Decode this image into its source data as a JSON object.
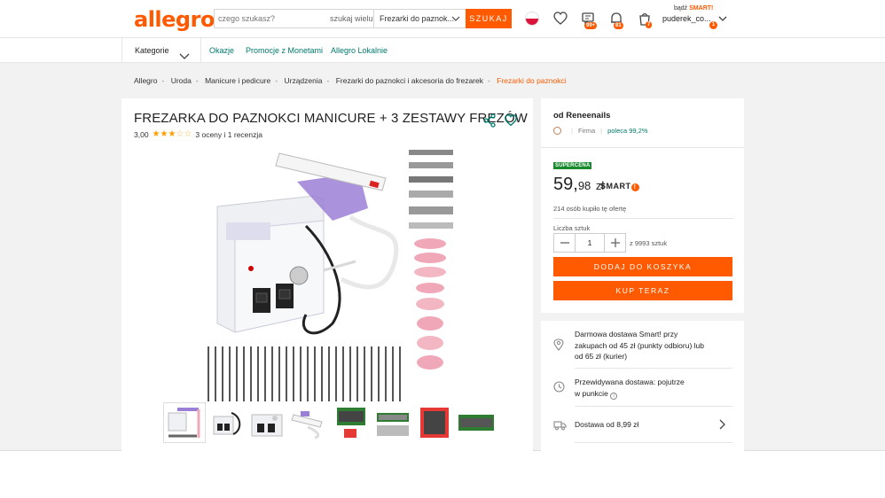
{
  "header": {
    "logo": "allegro",
    "search_placeholder": "czego szukasz?",
    "search_many": "szukaj wielu",
    "search_category": "Frezarki do paznok...",
    "search_button": "SZUKAJ",
    "badges": {
      "messages": "99+",
      "notifications": "81",
      "cart": "7"
    },
    "account_prefix": "bądź",
    "account_smart": "SMART!",
    "account_name": "puderek_co...",
    "account_badge": "1"
  },
  "nav": {
    "categories": "Kategorie",
    "links": [
      "Okazje",
      "Promocje z Monetami",
      "Allegro Lokalnie"
    ]
  },
  "breadcrumb": [
    "Allegro",
    "Uroda",
    "Manicure i pedicure",
    "Urządzenia",
    "Frezarki do paznokci i akcesoria do frezarek",
    "Frezarki do paznokci"
  ],
  "product": {
    "title": "FREZARKA DO PAZNOKCI MANICURE + 3 ZESTAWY FREZÓW",
    "rating_value": "3,00",
    "rating_info": "3 oceny i 1 recenzja",
    "stars": 3
  },
  "seller": {
    "name": "od Reneenails",
    "type": "Firma",
    "recommend": "poleca 99,2%"
  },
  "offer": {
    "supercena": "SUPERCENA",
    "price_whole": "59,",
    "price_cents": "98",
    "currency": "zł",
    "smart": "SMART",
    "bought": "214 osób kupiło tę ofertę",
    "qty_label": "Liczba sztuk",
    "qty_value": "1",
    "qty_max": "z 9993 sztuk",
    "add_to_cart": "DODAJ DO KOSZYKA",
    "buy_now": "KUP TERAZ"
  },
  "delivery": {
    "free": "Darmowa dostawa Smart! przy zakupach od 45 zł (punkty odbioru) lub od 65 zł (kurier)",
    "expected": "Przewidywana dostawa: pojutrze w punkcie",
    "cost": "Dostawa od 8,99 zł"
  },
  "colors": {
    "brand": "#ff5a00",
    "link": "#00796b",
    "supercena": "#1a8a2e"
  }
}
